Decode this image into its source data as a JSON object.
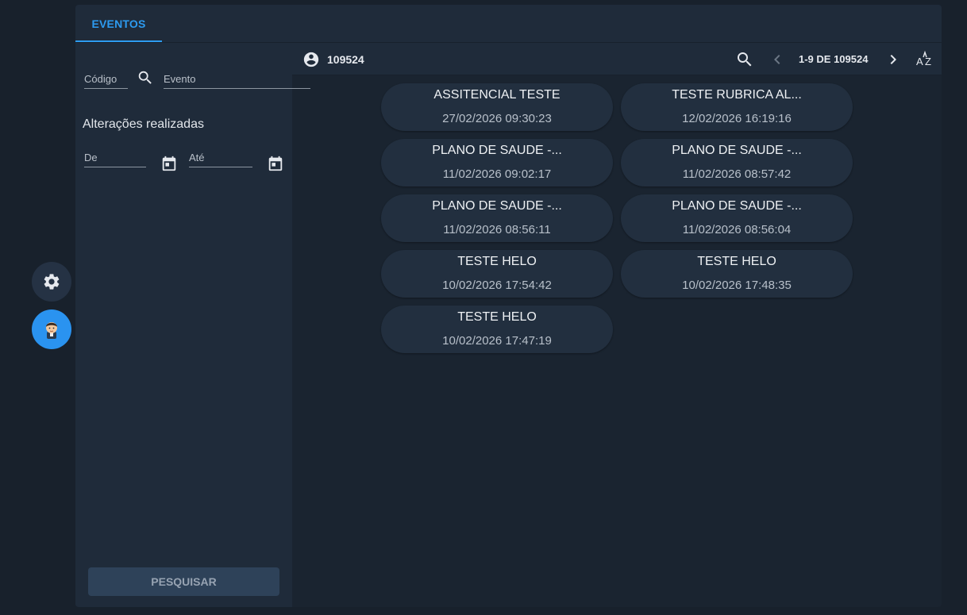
{
  "sidebar_actions": {
    "settings_icon": "gear-icon",
    "user_avatar_icon": "avatar-icon",
    "avatar_color": "#2a93f0"
  },
  "tabs": [
    {
      "label": "EVENTOS",
      "active": true
    }
  ],
  "filters": {
    "codigo_placeholder": "Código",
    "evento_placeholder": "Evento",
    "section_title": "Alterações realizadas",
    "de_placeholder": "De",
    "ate_placeholder": "Até",
    "search_button": "PESQUISAR"
  },
  "toolbar": {
    "account_label": "109524",
    "page_info": "1-9 DE 109524"
  },
  "events": [
    {
      "title": "ASSITENCIAL TESTE",
      "date": "27/02/2026 09:30:23"
    },
    {
      "title": "TESTE RUBRICA AL...",
      "date": "12/02/2026 16:19:16"
    },
    {
      "title": "PLANO DE SAUDE -...",
      "date": "11/02/2026 09:02:17"
    },
    {
      "title": "PLANO DE SAUDE -...",
      "date": "11/02/2026 08:57:42"
    },
    {
      "title": "PLANO DE SAUDE -...",
      "date": "11/02/2026 08:56:11"
    },
    {
      "title": "PLANO DE SAUDE -...",
      "date": "11/02/2026 08:56:04"
    },
    {
      "title": "TESTE HELO",
      "date": "10/02/2026 17:54:42"
    },
    {
      "title": "TESTE HELO",
      "date": "10/02/2026 17:48:35"
    },
    {
      "title": "TESTE HELO",
      "date": "10/02/2026 17:47:19"
    }
  ],
  "colors": {
    "accent": "#2d9bf0",
    "background": "#18212c",
    "panel": "#1f2b3a",
    "card": "#222f3f"
  }
}
